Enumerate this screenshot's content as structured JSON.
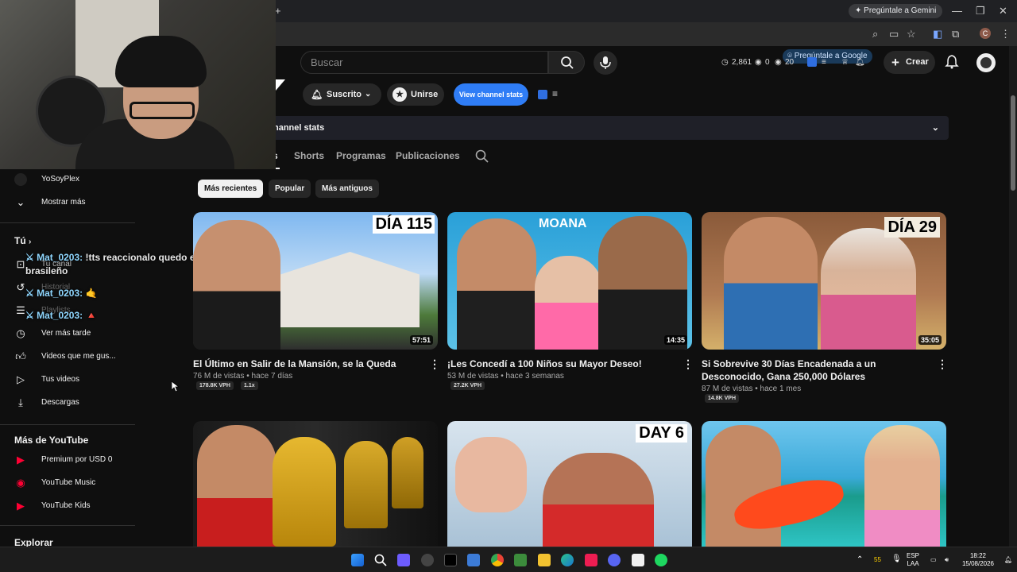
{
  "browser": {
    "new_tab": "+",
    "gemini_label": "Pregúntale a Gemini",
    "ask_google_label": "Pregúntale a Google",
    "profile_letter": "C",
    "window_controls": [
      "—",
      "❐",
      "✕"
    ]
  },
  "header": {
    "search_placeholder": "Buscar",
    "stats": {
      "views": "2,861",
      "eye_count": "0",
      "watching": "20"
    },
    "create_label": "Crear"
  },
  "channel_actions": {
    "subscribed_label": "Suscrito",
    "join_label": "Unirse",
    "view_stats_label": "View channel stats"
  },
  "stats_bar": {
    "label": "hannel stats"
  },
  "tabs": [
    {
      "label": "s"
    },
    {
      "label": "Shorts"
    },
    {
      "label": "Programas"
    },
    {
      "label": "Publicaciones"
    }
  ],
  "chips": [
    {
      "label": "Más recientes"
    },
    {
      "label": "Popular"
    },
    {
      "label": "Más antiguos"
    }
  ],
  "sidebar": {
    "top_items": [
      {
        "label": "YoSoyPlex"
      },
      {
        "label": "Mostrar más"
      }
    ],
    "you_heading": "Tú",
    "you_items": [
      {
        "label": "Tu canal"
      },
      {
        "label": "Historial"
      },
      {
        "label": "Playlists"
      },
      {
        "label": "Ver más tarde"
      },
      {
        "label": "Videos que me gus..."
      },
      {
        "label": "Tus videos"
      },
      {
        "label": "Descargas"
      }
    ],
    "more_heading": "Más de YouTube",
    "more_items": [
      {
        "label": "Premium por USD 0"
      },
      {
        "label": "YouTube Music"
      },
      {
        "label": "YouTube Kids"
      }
    ],
    "explore_heading": "Explorar"
  },
  "chat": [
    {
      "user": "Mat_0203:",
      "message": "!tts reaccionalo quedo el"
    },
    {
      "user": "",
      "message": "brasileño"
    },
    {
      "user": "Mat_0203:",
      "message": "🤙"
    },
    {
      "user": "Mat_0203:",
      "message": "🔺"
    }
  ],
  "videos": [
    {
      "title": "El Último en Salir de la Mansión, se la Queda",
      "meta": "76 M de vistas • hace 7 días",
      "vph": "178.8K VPH",
      "extra": "1.1x",
      "duration": "57:51",
      "thumb_text": "DÍA 115"
    },
    {
      "title": "¡Les Concedí a 100 Niños su Mayor Deseo!",
      "meta": "53 M de vistas • hace 3 semanas",
      "vph": "27.2K VPH",
      "extra": "",
      "duration": "14:35",
      "thumb_text": "MOANA"
    },
    {
      "title": "Si Sobrevive 30 Días Encadenada a un Desconocido, Gana 250,000 Dólares",
      "meta": "87 M de vistas • hace 1 mes",
      "vph": "14.8K VPH",
      "extra": "",
      "duration": "35:05",
      "thumb_text": "DÍA 29"
    },
    {
      "title": "",
      "meta": "",
      "vph": "",
      "extra": "",
      "duration": "",
      "thumb_text": ""
    },
    {
      "title": "",
      "meta": "",
      "vph": "",
      "extra": "",
      "duration": "",
      "thumb_text": "DAY 6"
    },
    {
      "title": "",
      "meta": "",
      "vph": "",
      "extra": "",
      "duration": "",
      "thumb_text": ""
    }
  ],
  "taskbar": {
    "tray": {
      "temp": "55",
      "lang_top": "ESP",
      "lang_bottom": "LAA",
      "time": "18:22",
      "date": "15/08/2026"
    }
  }
}
